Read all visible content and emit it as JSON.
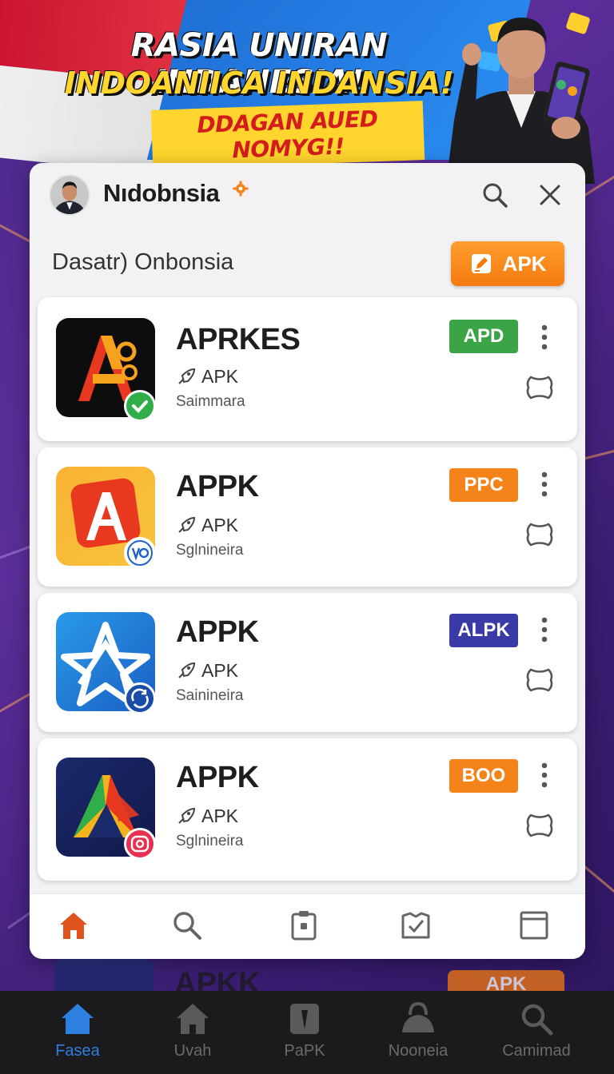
{
  "banner": {
    "line1": "RASIA UNIRAN INDANESIA!",
    "line2": "INDOANIICA INDANSIA!",
    "line3": "DDAGAN AUED NOMYG!!"
  },
  "header": {
    "brand": "Nıdobnsia",
    "section_title": "Dasatr) Onbonsia",
    "apk_button_label": "APK"
  },
  "apps": [
    {
      "name": "APRKES",
      "type": "APK",
      "developer": "Saimmara",
      "tag": "APD",
      "tag_color": "#3aa447"
    },
    {
      "name": "APPK",
      "type": "APK",
      "developer": "Sglnineira",
      "tag": "PPC",
      "tag_color": "#f4831a"
    },
    {
      "name": "APPK",
      "type": "APK",
      "developer": "Sainineira",
      "tag": "ALPK",
      "tag_color": "#3a3aa6"
    },
    {
      "name": "APPK",
      "type": "APK",
      "developer": "Sglnineira",
      "tag": "BOO",
      "tag_color": "#f4831a"
    }
  ],
  "peek": {
    "name": "APKK",
    "button": "APK"
  },
  "bottom_nav": [
    {
      "label": "Fasea"
    },
    {
      "label": "Uvah"
    },
    {
      "label": "PaPK"
    },
    {
      "label": "Nooneia"
    },
    {
      "label": "Camimad"
    }
  ],
  "colors": {
    "accent_orange": "#f47a10",
    "active_blue": "#2d7fe0",
    "home_orange": "#e0531c"
  }
}
